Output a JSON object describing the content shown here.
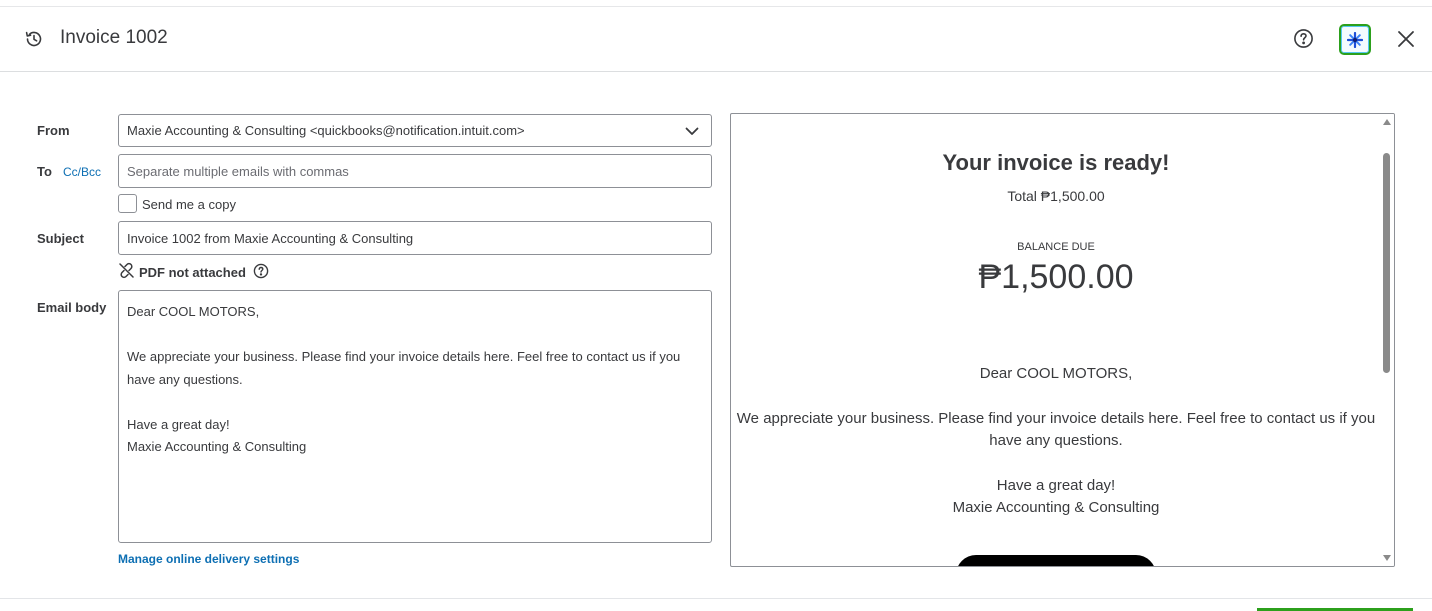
{
  "header": {
    "title": "Invoice 1002",
    "history_icon": "history-icon",
    "help_icon": "help-circle-icon",
    "ai_icon": "sparkle-icon",
    "close_icon": "close-icon"
  },
  "form": {
    "from_label": "From",
    "from_value": "Maxie Accounting & Consulting <quickbooks@notification.intuit.com>",
    "to_label": "To",
    "cc_bcc_link": "Cc/Bcc",
    "to_value": "",
    "to_placeholder": "Separate multiple emails with commas",
    "send_copy_label": "Send me a copy",
    "send_copy_checked": false,
    "subject_label": "Subject",
    "subject_value": "Invoice 1002 from Maxie Accounting & Consulting",
    "pdf_status": "PDF not attached",
    "email_body_label": "Email body",
    "email_body": {
      "greeting": "Dear COOL MOTORS,",
      "line1": "We appreciate your business. Please find your invoice details here. Feel free to contact us if you",
      "line2": "have any questions.",
      "closing": "Have a great day!",
      "signature": "Maxie Accounting & Consulting"
    },
    "manage_link": "Manage online delivery settings"
  },
  "preview": {
    "title": "Your invoice is ready!",
    "total": "Total ₱1,500.00",
    "balance_due_label": "BALANCE DUE",
    "balance_due_amount": "₱1,500.00",
    "greeting": "Dear COOL MOTORS,",
    "message_line1": "We appreciate your business. Please find your invoice details here. Feel free to contact us if you",
    "message_line2": "have any questions.",
    "closing": "Have a great day!",
    "signature": "Maxie Accounting & Consulting"
  },
  "colors": {
    "link": "#0d6fb3",
    "accent_green": "#2ca01c",
    "text": "#393a3d",
    "border": "#8d9096"
  }
}
